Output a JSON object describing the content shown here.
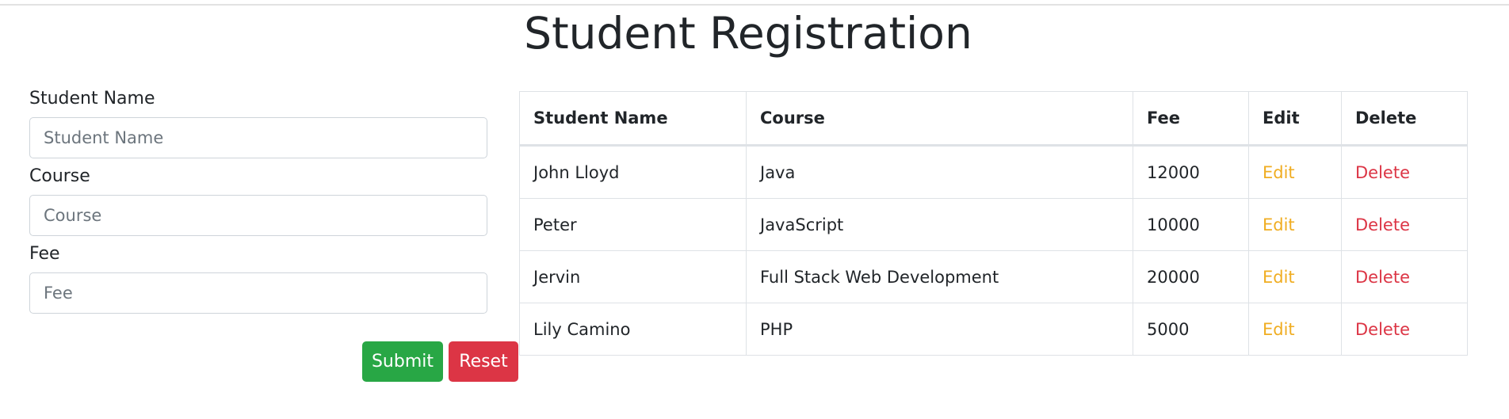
{
  "page": {
    "title": "Student Registration"
  },
  "form": {
    "fields": [
      {
        "label": "Student Name",
        "placeholder": "Student Name",
        "value": ""
      },
      {
        "label": "Course",
        "placeholder": "Course",
        "value": ""
      },
      {
        "label": "Fee",
        "placeholder": "Fee",
        "value": ""
      }
    ],
    "submit_label": "Submit",
    "reset_label": "Reset"
  },
  "table": {
    "headers": [
      "Student Name",
      "Course",
      "Fee",
      "Edit",
      "Delete"
    ],
    "rows": [
      {
        "name": "John Lloyd",
        "course": "Java",
        "fee": "12000",
        "edit": "Edit",
        "delete": "Delete"
      },
      {
        "name": "Peter",
        "course": "JavaScript",
        "fee": "10000",
        "edit": "Edit",
        "delete": "Delete"
      },
      {
        "name": "Jervin",
        "course": "Full Stack Web Development",
        "fee": "20000",
        "edit": "Edit",
        "delete": "Delete"
      },
      {
        "name": "Lily Camino",
        "course": "PHP",
        "fee": "5000",
        "edit": "Edit",
        "delete": "Delete"
      }
    ]
  },
  "colors": {
    "submit": "#28a745",
    "reset": "#dc3545",
    "edit_link": "#f0ad22",
    "delete_link": "#dc3545",
    "border": "#dee2e6",
    "text": "#212529"
  }
}
